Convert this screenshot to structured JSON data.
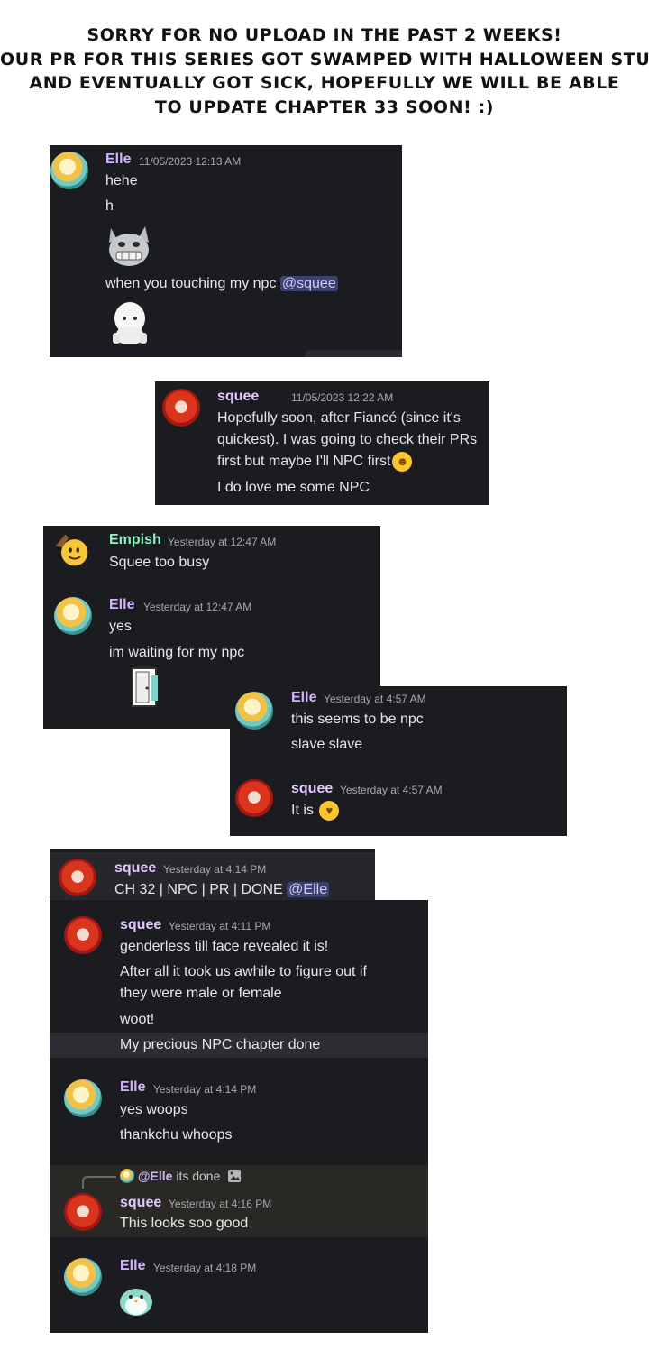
{
  "notice": {
    "lines": [
      "Sorry for no upload in the past 2 weeks!",
      "Our PR for this series got swamped with Halloween stuff",
      "and eventually got sick, hopefully we will be able",
      "to update Chapter 33 soon! :)"
    ]
  },
  "colors": {
    "panel_bg": "#1b1c20",
    "panel_alt_bg": "#26262b",
    "mention_bg": "#3c4270",
    "elle_name": "#d3b3ff",
    "empish_name": "#8ef0bc"
  },
  "p1": {
    "name": "Elle",
    "time": "11/05/2023 12:13 AM",
    "lines": [
      "hehe",
      "h"
    ],
    "caption": "when you touching my npc ",
    "mention": "@squee",
    "sticker1_icon": "grinning-cat-sticker",
    "sticker2_icon": "white-blob-sticker"
  },
  "p2": {
    "name": "squee",
    "time": "11/05/2023 12:22 AM",
    "lines": [
      "Hopefully soon, after Fiancé (since it's",
      "quickest). I was going to check their PRs",
      "first but maybe I'll NPC first"
    ],
    "emoji_icon": "rofl-emoji",
    "line4": "I do love me some NPC"
  },
  "p3": {
    "m1": {
      "name": "Empish",
      "time": "Yesterday at 12:47 AM",
      "text": "Squee too busy"
    },
    "m2": {
      "name": "Elle",
      "time": "Yesterday at 12:47 AM",
      "lines": [
        "yes",
        "im waiting for my npc"
      ],
      "sticker_icon": "door-sticker"
    }
  },
  "p4": {
    "m1": {
      "name": "Elle",
      "time": "Yesterday at 4:57 AM",
      "lines": [
        "this seems to be npc",
        "slave slave"
      ]
    },
    "m2": {
      "name": "squee",
      "time": "Yesterday at 4:57 AM",
      "text": "It is",
      "emoji_icon": "kiss-emoji"
    }
  },
  "p5": {
    "name": "squee",
    "time": "Yesterday at 4:14 PM",
    "text": "CH 32 | NPC | PR | DONE ",
    "mention": "@Elle"
  },
  "p6": {
    "m1": {
      "name": "squee",
      "time": "Yesterday at 4:11 PM",
      "lines": [
        "genderless till face revealed it is!",
        "After all it took us awhile to figure out if",
        "they were male or female",
        "woot!",
        "My precious NPC chapter done"
      ]
    },
    "m2": {
      "name": "Elle",
      "time": "Yesterday at 4:14 PM",
      "lines": [
        "yes woops",
        "thankchu whoops"
      ]
    },
    "reply": {
      "mention": "@Elle",
      "text": " its done",
      "icon": "image-icon"
    },
    "m3": {
      "name": "squee",
      "time": "Yesterday at 4:16 PM",
      "text": "This looks soo good"
    },
    "m4": {
      "name": "Elle",
      "time": "Yesterday at 4:18 PM",
      "sticker_icon": "penguin-sticker"
    }
  }
}
